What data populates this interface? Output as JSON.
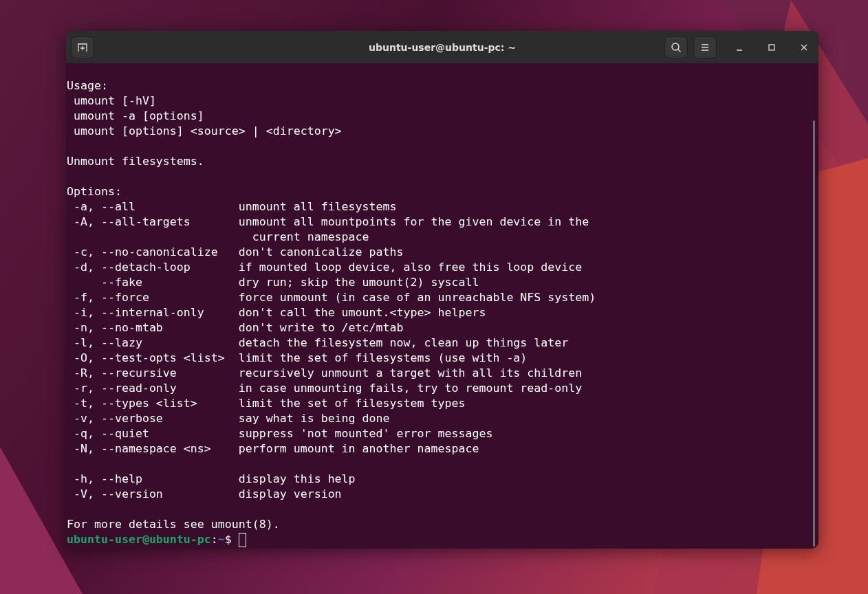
{
  "window": {
    "title": "ubuntu-user@ubuntu-pc: ~"
  },
  "output": [
    [
      "Usage:",
      " umount [-hV]",
      " umount -a [options]",
      " umount [options] <source> | <directory>"
    ],
    [
      "Unmount filesystems."
    ],
    [
      "Options:",
      " -a, --all               unmount all filesystems",
      " -A, --all-targets       unmount all mountpoints for the given device in the",
      "                           current namespace",
      " -c, --no-canonicalize   don't canonicalize paths",
      " -d, --detach-loop       if mounted loop device, also free this loop device",
      "     --fake              dry run; skip the umount(2) syscall",
      " -f, --force             force unmount (in case of an unreachable NFS system)",
      " -i, --internal-only     don't call the umount.<type> helpers",
      " -n, --no-mtab           don't write to /etc/mtab",
      " -l, --lazy              detach the filesystem now, clean up things later",
      " -O, --test-opts <list>  limit the set of filesystems (use with -a)",
      " -R, --recursive         recursively unmount a target with all its children",
      " -r, --read-only         in case unmounting fails, try to remount read-only",
      " -t, --types <list>      limit the set of filesystem types",
      " -v, --verbose           say what is being done",
      " -q, --quiet             suppress 'not mounted' error messages",
      " -N, --namespace <ns>    perform umount in another namespace"
    ],
    [
      " -h, --help              display this help",
      " -V, --version           display version"
    ],
    [
      "For more details see umount(8)."
    ]
  ],
  "prompt": {
    "user_host": "ubuntu-user@ubuntu-pc",
    "separator": ":",
    "path": "~",
    "symbol": "$"
  }
}
